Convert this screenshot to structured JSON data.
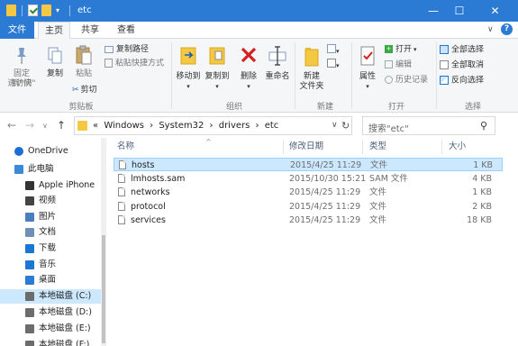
{
  "window": {
    "title": "etc",
    "title_dropdown": "▾",
    "min_glyph": "—",
    "max_glyph": "☐",
    "close_glyph": "✕"
  },
  "tabs": [
    {
      "label": "文件"
    },
    {
      "label": "主页"
    },
    {
      "label": "共享"
    },
    {
      "label": "查看"
    }
  ],
  "help_glyph": "?",
  "ribbon": {
    "clipboard": {
      "pin_label_1": "固定到\"快",
      "pin_label_2": "速访问\"",
      "copy_label": "复制",
      "paste_label": "粘贴",
      "copy_path_label": "复制路径",
      "paste_shortcut_label": "粘贴快捷方式",
      "cut_label": "剪切",
      "group_label": "剪贴板"
    },
    "organize": {
      "move_to_label": "移动到",
      "copy_to_label": "复制到",
      "delete_label": "删除",
      "rename_label": "重命名",
      "group_label": "组织"
    },
    "new": {
      "new_folder_label_1": "新建",
      "new_folder_label_2": "文件夹",
      "group_label": "新建"
    },
    "open": {
      "properties_label": "属性",
      "open_label": "打开",
      "edit_label": "编辑",
      "history_label": "历史记录",
      "group_label": "打开"
    },
    "select": {
      "select_all_label": "全部选择",
      "select_none_label": "全部取消",
      "invert_label": "反向选择",
      "group_label": "选择"
    }
  },
  "address": {
    "back": "←",
    "forward": "→",
    "recent": "∨",
    "up": "↑",
    "crumbs": [
      "«",
      "Windows",
      "›",
      "System32",
      "›",
      "drivers",
      "›",
      "etc"
    ],
    "dropdown": "∨",
    "refresh": "↻"
  },
  "search": {
    "placeholder": "搜索\"etc\"",
    "icon_glyph": "⚲"
  },
  "nav": [
    {
      "label": "OneDrive",
      "icon": "cloud-icon",
      "color": "#1a6fd4"
    },
    {
      "label": "此电脑",
      "icon": "computer-icon",
      "color": "#3a8ad8"
    },
    {
      "label": "Apple iPhone",
      "icon": "phone-icon",
      "color": "#333333"
    },
    {
      "label": "视频",
      "icon": "video-icon",
      "color": "#444444"
    },
    {
      "label": "图片",
      "icon": "pictures-icon",
      "color": "#4a7fbf"
    },
    {
      "label": "文档",
      "icon": "documents-icon",
      "color": "#6f8fb5"
    },
    {
      "label": "下载",
      "icon": "download-icon",
      "color": "#1a78d4"
    },
    {
      "label": "音乐",
      "icon": "music-icon",
      "color": "#1a78d4"
    },
    {
      "label": "桌面",
      "icon": "desktop-icon",
      "color": "#2a7bd4"
    },
    {
      "label": "本地磁盘 (C:)",
      "icon": "drive-icon",
      "color": "#6c6c6c"
    },
    {
      "label": "本地磁盘 (D:)",
      "icon": "drive-icon",
      "color": "#6c6c6c"
    },
    {
      "label": "本地磁盘 (E:)",
      "icon": "drive-icon",
      "color": "#6c6c6c"
    },
    {
      "label": "本地磁盘 (F:)",
      "icon": "drive-icon",
      "color": "#6c6c6c"
    }
  ],
  "nav_selected": "本地磁盘 (C:)",
  "columns": {
    "name": "名称",
    "date": "修改日期",
    "type": "类型",
    "size": "大小",
    "sort_glyph": "^"
  },
  "files": [
    {
      "name": "hosts",
      "date": "2015/4/25 11:29",
      "type": "文件",
      "size": "1 KB",
      "selected": true
    },
    {
      "name": "lmhosts.sam",
      "date": "2015/10/30 15:21",
      "type": "SAM 文件",
      "size": "4 KB",
      "selected": false
    },
    {
      "name": "networks",
      "date": "2015/4/25 11:29",
      "type": "文件",
      "size": "1 KB",
      "selected": false
    },
    {
      "name": "protocol",
      "date": "2015/4/25 11:29",
      "type": "文件",
      "size": "2 KB",
      "selected": false
    },
    {
      "name": "services",
      "date": "2015/4/25 11:29",
      "type": "文件",
      "size": "18 KB",
      "selected": false
    }
  ],
  "colors": {
    "accent": "#2b7bd4",
    "selection": "#cce8ff",
    "selection_border": "#99d1ff",
    "delete_red": "#d32020",
    "folder_yellow": "#f4c842"
  }
}
